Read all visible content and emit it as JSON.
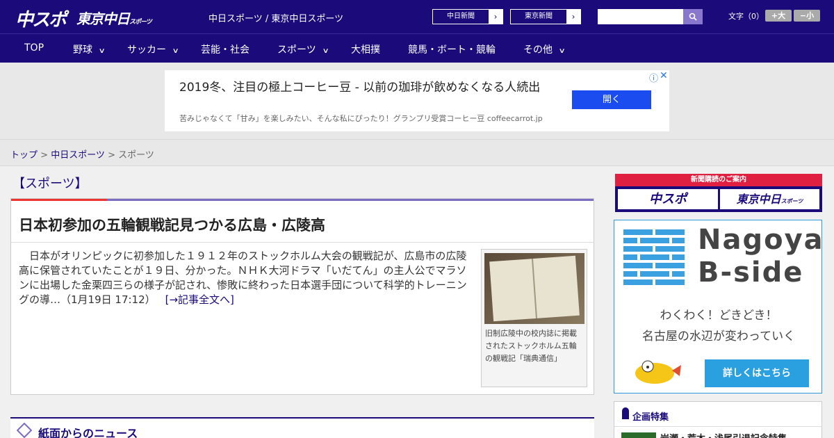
{
  "header": {
    "logo_chuspo": "中スポ",
    "logo_tokyo": "東京中日",
    "logo_tokyo_suffix": "スポーツ",
    "site_name": "中日スポーツ / 東京中日スポーツ",
    "link1": "中日新聞",
    "link2": "東京新聞",
    "search_placeholder": "",
    "font_size_label": "文字（0）",
    "font_plus": "+大",
    "font_minus": "−小"
  },
  "nav": [
    "TOP",
    "野球",
    "サッカー",
    "芸能・社会",
    "スポーツ",
    "大相撲",
    "競馬・ボート・競輪",
    "その他"
  ],
  "ad": {
    "title": "2019冬、注目の極上コーヒー豆 - 以前の珈琲が飲めなくなる人続出",
    "sub": "苦みじゃなくて「甘み」を楽しみたい、そんな私にぴったり！グランプリ受賞コーヒー豆 coffeecarrot.jp",
    "open": "開く"
  },
  "breadcrumb": {
    "top": "トップ",
    "sep1": " > ",
    "chunichi": "中日スポーツ",
    "sep2": " > ",
    "current": "スポーツ"
  },
  "section_title": "【スポーツ】",
  "article": {
    "title": "日本初参加の五輪観戦記見つかる広島・広陵高",
    "body": "日本がオリンピックに初参加した１９１２年のストックホルム大会の観戦記が、広島市の広陵高に保管されていたことが１９日、分かった。ＮＨＫ大河ドラマ「いだてん」の主人公でマラソンに出場した金栗四三らの様子が記され、惨敗に終わった日本選手団について科学的トレーニングの導…（1月19日 17:12）",
    "more": "[→記事全文へ]",
    "caption": "旧制広陵中の校内誌に掲載されたストックホルム五輪の観戦記「瑞典通信」"
  },
  "news_box_title": "紙面からのニュース",
  "sidebar": {
    "subscribe_head": "新聞購読のご案内",
    "sub_logo1": "中スポ",
    "sub_logo2": "東京中日",
    "sub_logo2_suffix": "スポーツ",
    "bside_word1": "Nagoya",
    "bside_word2": "B-side",
    "bside_line1": "わくわく！どきどき！",
    "bside_line2": "名古屋の水辺が変わっていく",
    "bside_btn": "詳しくはこちら",
    "kikaku_title": "企画特集",
    "kikaku_item": "岩瀬・荒木・浅尾引退記念特集"
  },
  "colors": {
    "brand": "#1a0a7a",
    "accent_red": "#e02040",
    "ad_button": "#1a4cf0",
    "bside_blue": "#2aa0e0"
  }
}
